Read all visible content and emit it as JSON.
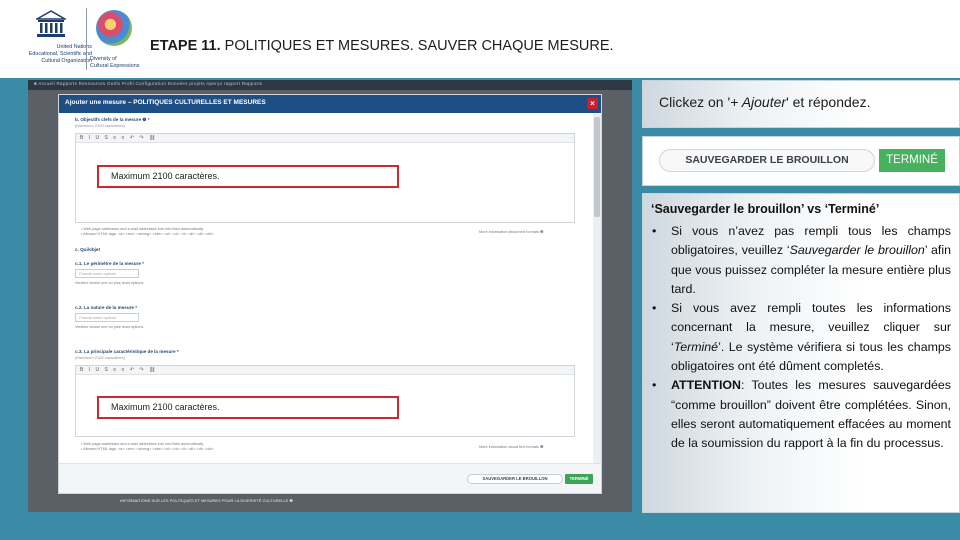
{
  "header": {
    "unesco_lines": [
      "United Nations",
      "Educational, Scientific and",
      "Cultural Organization"
    ],
    "convention_lines": [
      "Diversity of",
      "Cultural Expressions"
    ],
    "title_bold": "ETAPE 11.",
    "title_rest": " POLITIQUES ET MESURES. SAUVER CHAQUE MESURE."
  },
  "screenshot": {
    "nav_text": "■   Accueil    Rapports    Ressources    Outils    Profil    Configuration    Données projets    Aperçu rapport    Rapports",
    "modal_title": "Ajouter une mesure – POLITIQUES CULTURELLES ET MESURES",
    "close_glyph": "×",
    "section_b_label": "b. Objectifs clefs de la mesure ❷  *",
    "section_b_sub": "(Maximum 2100 caractères)",
    "editor_toolbar": "B I U S ≡ ≡ ↶ ↷ ⛓",
    "hint1_lines": [
      "• Web page addresses and e-mail addresses turn into links automatically.",
      "• Allowed HTML tags: <a> <em> <strong> <cite> <ul> <ol> <li> <dl> <dt> <dd>"
    ],
    "more_info": "More information about text formats ❷",
    "section_c_label": "c. Qui/objet",
    "c1_label": "c.1. Le périmètre de la mesure  *",
    "c1_select": "Choose some options",
    "c1_hint": "Veuillez choisir une ou plus ieurs options",
    "c2_label": "c.2. La nature de la mesure  *",
    "c2_select": "Choose some options",
    "c2_hint": "Veuillez choisir une ou plus ieurs options",
    "c3_label": "c.3. La principale caractéristique de la mesure  *",
    "c3_sub": "(Maximum 2100 caractères)",
    "hint2_lines": [
      "• Web page addresses and e-mail addresses turn into links automatically.",
      "• Allowed HTML tags: <a> <em> <strong> <cite> <ul> <ol> <li> <dl> <dt> <dd>"
    ],
    "more_info2": "More information about text formats ❷",
    "save_small": "SAUVEGARDER LE BROUILLON",
    "done_small": "TERMINÉ",
    "below_text": "INFORMATIONS SUR LES POLITIQUES ET MESURES POUR LA DIVERSITÉ CULTURELLE ❷"
  },
  "red_boxes": {
    "box1": "Maximum 2100 caractères.",
    "box2": "Maximum 2100 caractères."
  },
  "callout1": {
    "prefix": "Clickez on '",
    "italic": "+ Ajouter",
    "suffix": "' et répondez."
  },
  "callout2": {
    "save_label": "SAUVEGARDER LE BROUILLON",
    "done_label": "TERMINÉ"
  },
  "callout3": {
    "title": "‘Sauvegarder le brouillon’ vs ‘Terminé’",
    "bullet_glyph": "•",
    "b1_a": "Si vous n’avez pas rempli tous les champs obligatoires, veuillez ‘",
    "b1_em": "Sauvegarder le brouillon",
    "b1_b": "’ afin que vous puissez compléter la mesure entière plus tard.",
    "b2_a": "Si vous avez rempli toutes les informations concernant la mesure, veuillez cliquer sur ‘",
    "b2_em": "Terminé",
    "b2_b": "’. Le système vérifiera si tous les champs obligatoires ont été dûment completés.",
    "b3_bold": "ATTENTION",
    "b3_rest": ": Toutes les mesures sauvegardées “comme brouillon” doivent être complétées. Sinon, elles seront automatiquement effacées au moment de la soumission du rapport à la fin du processus."
  },
  "colors": {
    "background": "#3a8ba6",
    "modal_header": "#1e4f84",
    "done_green": "#48b15f",
    "red_outline": "#d0262d"
  }
}
